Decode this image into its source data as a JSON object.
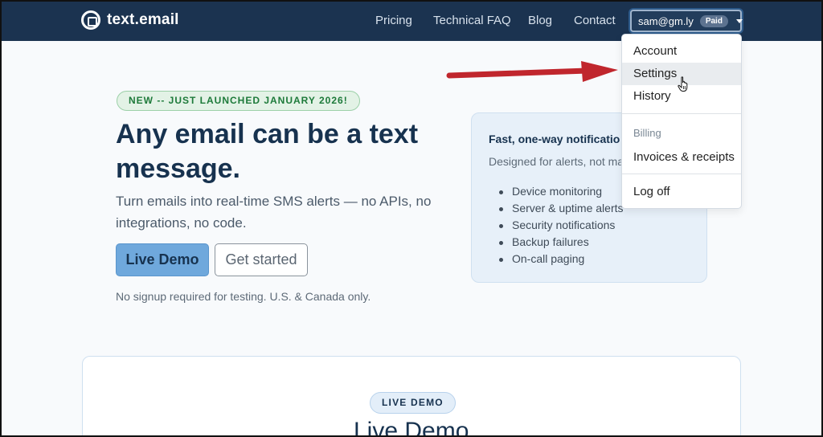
{
  "nav": {
    "brand": "text.email",
    "links": [
      "Pricing",
      "Technical FAQ",
      "Blog",
      "Contact"
    ],
    "user_email": "sam@gm.ly",
    "plan_badge": "Paid"
  },
  "dropdown": {
    "items": [
      "Account",
      "Settings",
      "History"
    ],
    "section_header": "Billing",
    "billing_item": "Invoices & receipts",
    "logout": "Log off",
    "hovered": "Settings"
  },
  "hero": {
    "announcement": "NEW -- JUST LAUNCHED JANUARY 2026!",
    "title": "Any email can be a text message.",
    "subtitle": "Turn emails into real-time SMS alerts — no APIs, no integrations, no code.",
    "demo_button": "Live Demo",
    "start_button": "Get started",
    "note": "No signup required for testing. U.S. & Canada only."
  },
  "card": {
    "title": "Fast, one-way notificatio",
    "description": "Designed for alerts, not ma",
    "items": [
      "Device monitoring",
      "Server & uptime alerts",
      "Security notifications",
      "Backup failures",
      "On-call paging"
    ]
  },
  "lower": {
    "badge": "LIVE DEMO",
    "title": "Live Demo"
  },
  "colors": {
    "nav_bg": "#1b3350",
    "primary_button": "#6fa8dc",
    "annotation_arrow": "#c0262d"
  }
}
